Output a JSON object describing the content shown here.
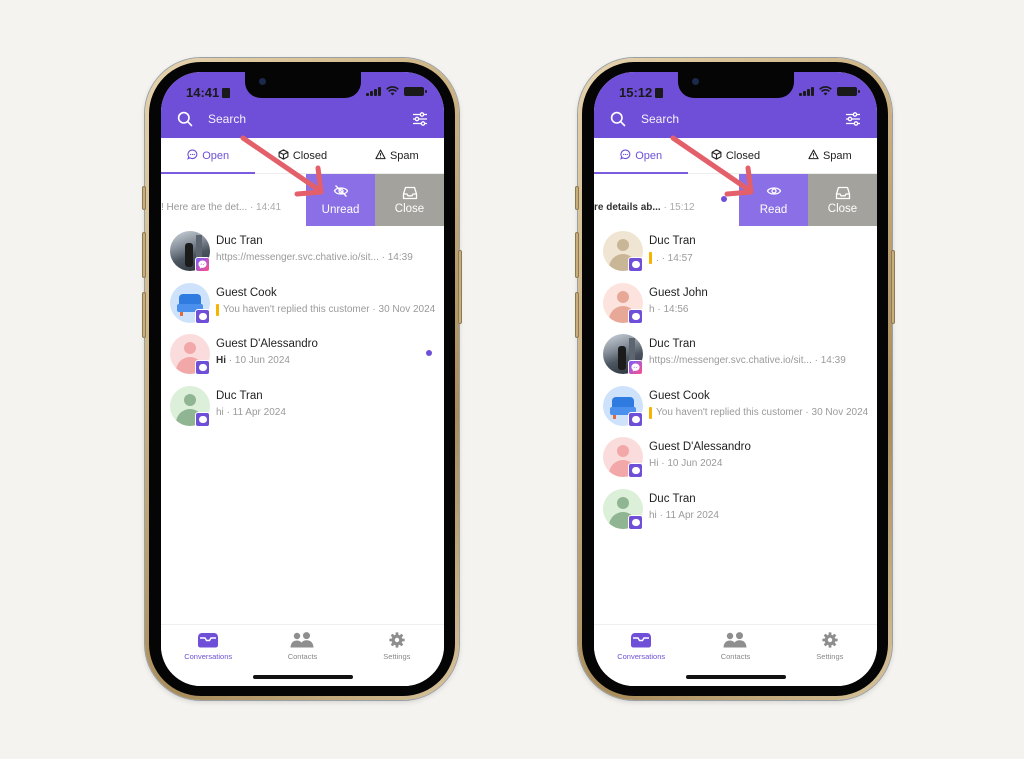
{
  "colors": {
    "brand": "#6f4fd8",
    "unread_action": "#8b6fe6",
    "close_action": "#a3a29d",
    "annotation_arrow": "#e3606a",
    "unreplied_marker": "#f5b400",
    "background": "#f4f3ef"
  },
  "phones": [
    {
      "status_time": "14:41",
      "search_placeholder": "Search",
      "search_icon": "search-icon",
      "filter_icon": "sliders-icon",
      "tabs": [
        {
          "label": "Open",
          "icon": "chat-bubble-icon",
          "active": true
        },
        {
          "label": "Closed",
          "icon": "box-icon",
          "active": false
        },
        {
          "label": "Spam",
          "icon": "warning-icon",
          "active": false
        }
      ],
      "swiped_row": {
        "preview": "! Here are the det...",
        "time": "· 14:41",
        "bold": false,
        "actions": [
          {
            "label": "Unread",
            "icon": "eye-off-icon"
          },
          {
            "label": "Close",
            "icon": "inbox-icon"
          }
        ]
      },
      "conversations": [
        {
          "name": "Duc Tran",
          "preview": "https://messenger.svc.chative.io/sit...",
          "time": "· 14:39",
          "channel": "messenger",
          "avatar": "photo",
          "unreplied": false,
          "unread": false
        },
        {
          "name": "Guest Cook",
          "preview": "You haven't replied this customer",
          "time": "· 30 Nov 2024",
          "channel": "livechat",
          "avatar": "sofa",
          "unreplied": true,
          "unread": false
        },
        {
          "name": "Guest D'Alessandro",
          "preview": "Hi",
          "time": "· 10 Jun 2024",
          "channel": "livechat",
          "avatar": "pink",
          "unreplied": false,
          "unread": true
        },
        {
          "name": "Duc Tran",
          "preview": "hi",
          "time": "· 11 Apr 2024",
          "channel": "livechat",
          "avatar": "green",
          "unreplied": false,
          "unread": false
        }
      ],
      "bottom_nav": [
        {
          "label": "Conversations",
          "icon": "inbox-tray-icon",
          "active": true
        },
        {
          "label": "Contacts",
          "icon": "people-icon",
          "active": false
        },
        {
          "label": "Settings",
          "icon": "gear-icon",
          "active": false
        }
      ]
    },
    {
      "status_time": "15:12",
      "search_placeholder": "Search",
      "search_icon": "search-icon",
      "filter_icon": "sliders-icon",
      "tabs": [
        {
          "label": "Open",
          "icon": "chat-bubble-icon",
          "active": true
        },
        {
          "label": "Closed",
          "icon": "box-icon",
          "active": false
        },
        {
          "label": "Spam",
          "icon": "warning-icon",
          "active": false
        }
      ],
      "swiped_row": {
        "preview": "re details ab...",
        "time": "· 15:12",
        "bold": true,
        "actions": [
          {
            "label": "Read",
            "icon": "eye-icon"
          },
          {
            "label": "Close",
            "icon": "inbox-icon"
          }
        ]
      },
      "conversations": [
        {
          "name": "Duc Tran",
          "preview": ".",
          "time": "· 14:57",
          "channel": "livechat",
          "avatar": "beige",
          "unreplied": true,
          "unread": false
        },
        {
          "name": "Guest John",
          "preview": "h",
          "time": "· 14:56",
          "channel": "livechat",
          "avatar": "salmon",
          "unreplied": false,
          "unread": false
        },
        {
          "name": "Duc Tran",
          "preview": "https://messenger.svc.chative.io/sit...",
          "time": "· 14:39",
          "channel": "messenger",
          "avatar": "photo",
          "unreplied": false,
          "unread": false
        },
        {
          "name": "Guest Cook",
          "preview": "You haven't replied this customer",
          "time": "· 30 Nov 2024",
          "channel": "livechat",
          "avatar": "sofa",
          "unreplied": true,
          "unread": false
        },
        {
          "name": "Guest D'Alessandro",
          "preview": "Hi",
          "time": "· 10 Jun 2024",
          "channel": "livechat",
          "avatar": "pink",
          "unreplied": false,
          "unread": false
        },
        {
          "name": "Duc Tran",
          "preview": "hi",
          "time": "· 11 Apr 2024",
          "channel": "livechat",
          "avatar": "green",
          "unreplied": false,
          "unread": false
        }
      ],
      "bottom_nav": [
        {
          "label": "Conversations",
          "icon": "inbox-tray-icon",
          "active": true
        },
        {
          "label": "Contacts",
          "icon": "people-icon",
          "active": false
        },
        {
          "label": "Settings",
          "icon": "gear-icon",
          "active": false
        }
      ]
    }
  ]
}
